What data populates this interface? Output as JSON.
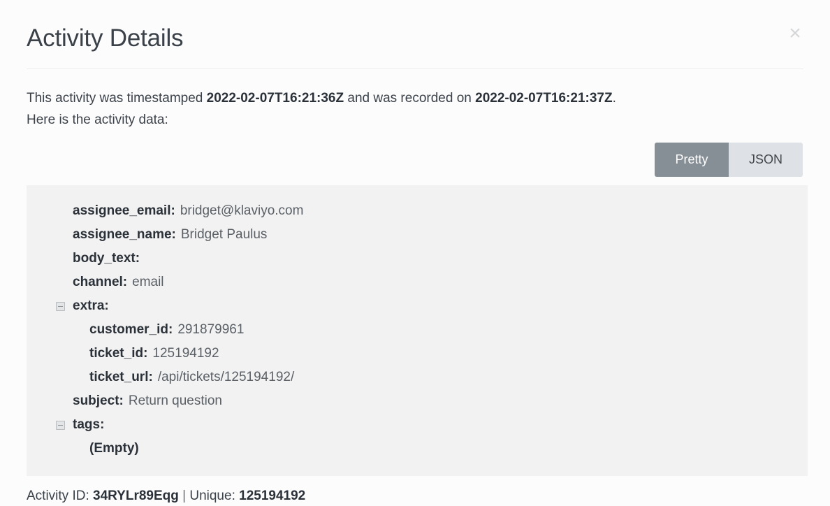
{
  "header": {
    "title": "Activity Details",
    "close_icon_label": "×"
  },
  "intro": {
    "prefix": "This activity was timestamped ",
    "timestamped_at": "2022-02-07T16:21:36Z",
    "middle": " and was recorded on ",
    "recorded_at": "2022-02-07T16:21:37Z",
    "suffix": ".",
    "line2": "Here is the activity data:"
  },
  "view_toggle": {
    "pretty_label": "Pretty",
    "json_label": "JSON",
    "selected": "Pretty",
    "active_bg": "#868e96",
    "inactive_bg": "#dee2e6"
  },
  "activity_data": {
    "rows": [
      {
        "level": 0,
        "collapsible": false,
        "key": "assignee_email:",
        "value": "bridget@klaviyo.com",
        "value_bold": false
      },
      {
        "level": 0,
        "collapsible": false,
        "key": "assignee_name:",
        "value": "Bridget Paulus",
        "value_bold": false
      },
      {
        "level": 0,
        "collapsible": false,
        "key": "body_text:",
        "value": "",
        "value_bold": false
      },
      {
        "level": 0,
        "collapsible": false,
        "key": "channel:",
        "value": "email",
        "value_bold": false
      },
      {
        "level": 0,
        "collapsible": true,
        "key": "extra:",
        "value": "",
        "value_bold": false
      },
      {
        "level": 1,
        "collapsible": false,
        "key": "customer_id:",
        "value": "291879961",
        "value_bold": false
      },
      {
        "level": 1,
        "collapsible": false,
        "key": "ticket_id:",
        "value": "125194192",
        "value_bold": false
      },
      {
        "level": 1,
        "collapsible": false,
        "key": "ticket_url:",
        "value": "/api/tickets/125194192/",
        "value_bold": false
      },
      {
        "level": 0,
        "collapsible": false,
        "key": "subject:",
        "value": "Return question",
        "value_bold": false
      },
      {
        "level": 0,
        "collapsible": true,
        "key": "tags:",
        "value": "",
        "value_bold": false
      },
      {
        "level": 1,
        "collapsible": false,
        "key": "(Empty)",
        "value": "",
        "value_bold": true
      }
    ],
    "panel_bg": "#f2f2f2"
  },
  "footer": {
    "activity_id_label": "Activity ID:",
    "activity_id": "34RYLr89Eqg",
    "separator": "|",
    "unique_label": "Unique:",
    "unique_id": "125194192"
  }
}
